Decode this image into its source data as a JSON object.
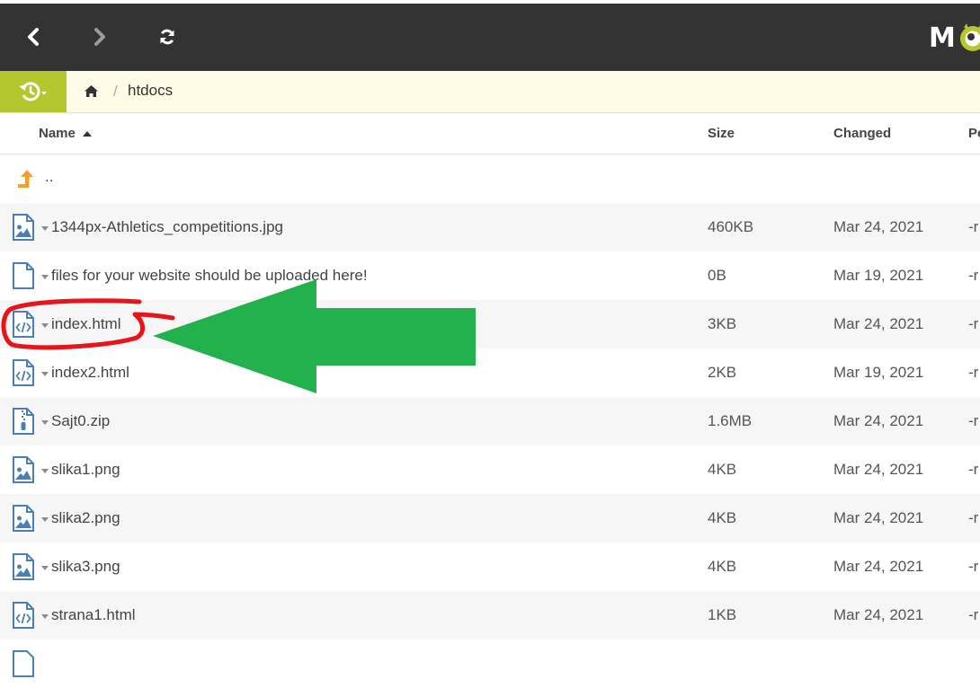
{
  "toolbar": {
    "back_icon": "chevron-left-icon",
    "forward_icon": "chevron-right-icon",
    "refresh_icon": "refresh-icon"
  },
  "brand": {
    "text": "MO"
  },
  "breadcrumb": {
    "history_icon": "history-icon",
    "home_icon": "home-icon",
    "separator": "/",
    "current": "htdocs"
  },
  "table": {
    "headers": {
      "name": "Name",
      "size": "Size",
      "changed": "Changed",
      "permissions": "Pe"
    },
    "parent": {
      "label": ".."
    },
    "rows": [
      {
        "name": "1344px-Athletics_competitions.jpg",
        "size": "460KB",
        "changed": "Mar 24, 2021",
        "perm": "-r",
        "icon": "image-file-icon"
      },
      {
        "name": "files for your website should be uploaded here!",
        "size": "0B",
        "changed": "Mar 19, 2021",
        "perm": "-r",
        "icon": "file-icon"
      },
      {
        "name": "index.html",
        "size": "3KB",
        "changed": "Mar 24, 2021",
        "perm": "-r",
        "icon": "code-file-icon"
      },
      {
        "name": "index2.html",
        "size": "2KB",
        "changed": "Mar 19, 2021",
        "perm": "-r",
        "icon": "code-file-icon"
      },
      {
        "name": "Sajt0.zip",
        "size": "1.6MB",
        "changed": "Mar 24, 2021",
        "perm": "-r",
        "icon": "zip-file-icon"
      },
      {
        "name": "slika1.png",
        "size": "4KB",
        "changed": "Mar 24, 2021",
        "perm": "-r",
        "icon": "image-file-icon"
      },
      {
        "name": "slika2.png",
        "size": "4KB",
        "changed": "Mar 24, 2021",
        "perm": "-r",
        "icon": "image-file-icon"
      },
      {
        "name": "slika3.png",
        "size": "4KB",
        "changed": "Mar 24, 2021",
        "perm": "-r",
        "icon": "image-file-icon"
      },
      {
        "name": "strana1.html",
        "size": "1KB",
        "changed": "Mar 24, 2021",
        "perm": "-r",
        "icon": "code-file-icon"
      }
    ]
  },
  "colors": {
    "topbar": "#333333",
    "accent": "#b5c72e",
    "breadcrumb_bg": "#fefbe6",
    "annotation_circle": "#e8141c",
    "annotation_arrow": "#22b14c",
    "icon_blue": "#4a7fb5",
    "up_arrow": "#f0a030"
  }
}
